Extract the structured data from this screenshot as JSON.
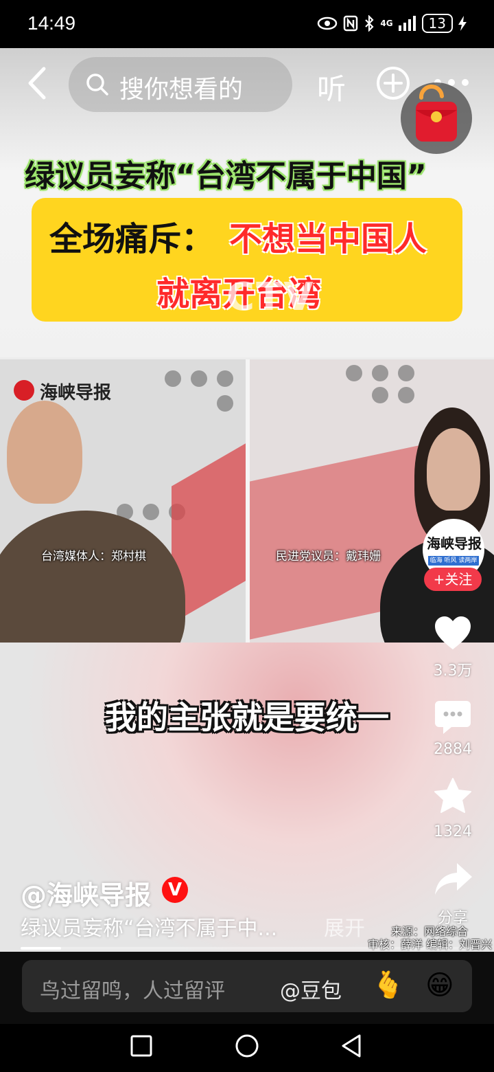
{
  "status_bar": {
    "time": "14:49",
    "network": "4G",
    "battery": "13"
  },
  "top_bar": {
    "search_placeholder": "搜你想看的",
    "listen_label": "听"
  },
  "video": {
    "headline_line1": "绿议员妄称“台湾不属于中国”",
    "headline_black": "全场痛斥：",
    "headline_red_1": "不想当中国人",
    "headline_red_2": "就离开台湾",
    "logo_text": "海峡导报",
    "caption_left": "台湾媒体人：郑村棋",
    "caption_right": "民进党议员：戴玮姗",
    "watermark": "CTV",
    "subtitle": "我的主张就是要统一",
    "progress_fraction": 0.09
  },
  "actions": {
    "avatar_text": "海峡导报",
    "avatar_sub": "临海 听风 读两岸",
    "follow_label": "+关注",
    "like_count": "3.3万",
    "comment_count": "2884",
    "favorite_count": "1324",
    "share_label": "分享"
  },
  "post": {
    "author": "@海峡导报",
    "verified_mark": "V",
    "description": "绿议员妄称“台湾不属于中...",
    "expand_label": "展开",
    "source_line1": "来源：网络综合",
    "source_line2": "审核：薛洋 编辑：刘晋兴"
  },
  "comment_bar": {
    "placeholder": "鸟过留鸣，人过留评",
    "mention": "@豆包",
    "emoji_heart": "🫰",
    "emoji_grin": "😁"
  },
  "colors": {
    "accent_red": "#f23a4a",
    "headline_yellow": "#ffd51f",
    "headline_red": "#ff2a2a"
  }
}
